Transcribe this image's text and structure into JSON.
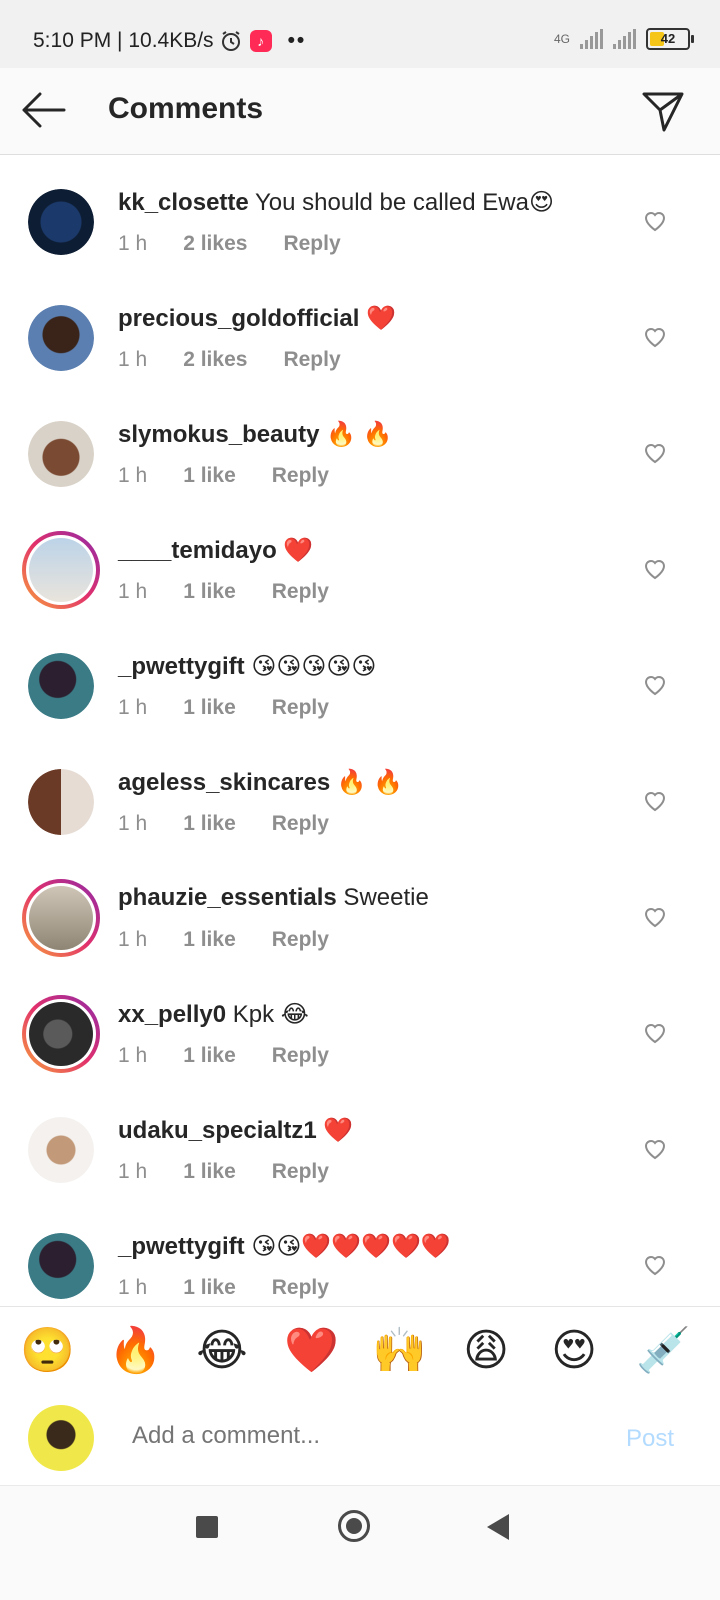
{
  "status_bar": {
    "time_speed": "5:10 PM | 10.4KB/s",
    "alarm_icon": "alarm-icon",
    "app_icon": "tiktok-icon",
    "dots": "••",
    "network": "4G",
    "battery": "42"
  },
  "header": {
    "title": "Comments",
    "back_icon": "arrow-left-icon",
    "send_icon": "paper-plane-icon"
  },
  "comments": [
    {
      "user": "kk_closette",
      "text": " You should be called Ewa😍",
      "time": "1 h",
      "likes": "2 likes",
      "reply": "Reply"
    },
    {
      "user": "precious_goldofficial",
      "text": " ❤️",
      "time": "1 h",
      "likes": "2 likes",
      "reply": "Reply"
    },
    {
      "user": "slymokus_beauty",
      "text": " 🔥 🔥",
      "time": "1 h",
      "likes": "1 like",
      "reply": "Reply"
    },
    {
      "user": "____temidayo",
      "text": " ❤️",
      "time": "1 h",
      "likes": "1 like",
      "reply": "Reply"
    },
    {
      "user": "_pwettygift",
      "text": " 😘😘😘😘😘",
      "time": "1 h",
      "likes": "1 like",
      "reply": "Reply"
    },
    {
      "user": "ageless_skincares",
      "text": " 🔥 🔥",
      "time": "1 h",
      "likes": "1 like",
      "reply": "Reply"
    },
    {
      "user": "phauzie_essentials",
      "text": " Sweetie",
      "time": "1 h",
      "likes": "1 like",
      "reply": "Reply"
    },
    {
      "user": "xx_pelly0",
      "text": " Kpk 😂",
      "time": "1 h",
      "likes": "1 like",
      "reply": "Reply"
    },
    {
      "user": "udaku_specialtz1",
      "text": " ❤️",
      "time": "1 h",
      "likes": "1 like",
      "reply": "Reply"
    },
    {
      "user": "_pwettygift",
      "text": " 😘😘❤️❤️❤️❤️❤️",
      "time": "1 h",
      "likes": "1 like",
      "reply": "Reply"
    }
  ],
  "emoji_bar": [
    "🙄",
    "🔥",
    "😂",
    "❤️",
    "🙌",
    "😩",
    "😍",
    "💉"
  ],
  "composer": {
    "placeholder": "Add a comment...",
    "post_label": "Post"
  },
  "colors": {
    "post_disabled": "#b3dbff",
    "meta_gray": "#8e8e8e",
    "story_ring": "#e1306c"
  }
}
